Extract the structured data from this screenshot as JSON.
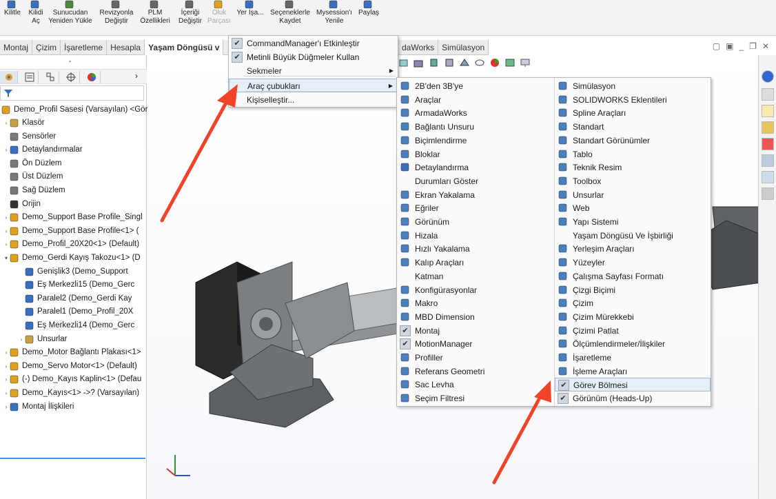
{
  "ribbon": {
    "buttons": [
      {
        "label": "Kilitle",
        "icon": "lock-icon"
      },
      {
        "label": "Kilidi Aç",
        "icon": "unlock-icon"
      },
      {
        "label": "Sunucudan Yeniden Yükle",
        "icon": "reload-icon"
      },
      {
        "label": "Revizyonla Değiştir",
        "icon": "revision-icon"
      },
      {
        "label": "PLM Özellikleri",
        "icon": "properties-icon"
      },
      {
        "label": "İçeriği Değiştir",
        "icon": "content-icon"
      },
      {
        "label": "Oluk Parçası",
        "icon": "part-icon",
        "disabled": true
      },
      {
        "label": "Yer İşa...",
        "icon": "bookmark-icon"
      },
      {
        "label": "Seçeneklerle Kaydet",
        "icon": "save-options-icon"
      },
      {
        "label": "Mysession'ı Yenile",
        "icon": "refresh-icon"
      },
      {
        "label": "Paylaş",
        "icon": "share-icon"
      }
    ]
  },
  "command_tabs": [
    "Montaj",
    "Çizim",
    "İşaretleme",
    "Hesapla",
    "Yaşam Döngüsü v"
  ],
  "command_tabs_right": [
    "daWorks",
    "Simülasyon"
  ],
  "tree": {
    "root": "Demo_Profil Sasesi (Varsayılan) <Gör",
    "items": [
      {
        "label": "Klasör",
        "expand": true,
        "indent": 0,
        "icon": "folder-icon"
      },
      {
        "label": "Sensörler",
        "expand": false,
        "indent": 0,
        "icon": "sensor-icon"
      },
      {
        "label": "Detaylandırmalar",
        "expand": true,
        "indent": 0,
        "icon": "annotation-icon"
      },
      {
        "label": "Ön Düzlem",
        "expand": false,
        "indent": 0,
        "icon": "plane-icon"
      },
      {
        "label": "Üst Düzlem",
        "expand": false,
        "indent": 0,
        "icon": "plane-icon"
      },
      {
        "label": "Sağ Düzlem",
        "expand": false,
        "indent": 0,
        "icon": "plane-icon"
      },
      {
        "label": "Orijin",
        "expand": false,
        "indent": 0,
        "icon": "origin-icon"
      },
      {
        "label": "Demo_Support Base Profile_Singl",
        "expand": true,
        "indent": 0,
        "icon": "part-icon"
      },
      {
        "label": "Demo_Support Base Profile<1> (",
        "expand": true,
        "indent": 0,
        "icon": "part-icon"
      },
      {
        "label": "Demo_Profil_20X20<1> (Default)",
        "expand": true,
        "indent": 0,
        "icon": "part-icon"
      },
      {
        "label": "Demo_Gerdi Kayış Takozu<1> (D",
        "expand": "open",
        "indent": 0,
        "icon": "part-icon"
      },
      {
        "label": "Genişlik3 (Demo_Support",
        "expand": false,
        "indent": 1,
        "icon": "mate-icon"
      },
      {
        "label": "Eş Merkezli15 (Demo_Gerc",
        "expand": false,
        "indent": 1,
        "icon": "mate-icon"
      },
      {
        "label": "Paralel2 (Demo_Gerdi Kay",
        "expand": false,
        "indent": 1,
        "icon": "mate-icon"
      },
      {
        "label": "Paralel1 (Demo_Profil_20X",
        "expand": false,
        "indent": 1,
        "icon": "mate-icon"
      },
      {
        "label": "Eş Merkezli14 (Demo_Gerc",
        "expand": false,
        "indent": 1,
        "icon": "mate-icon"
      },
      {
        "label": "Unsurlar",
        "expand": true,
        "indent": 1,
        "icon": "folder-icon"
      },
      {
        "label": "Demo_Motor Bağlantı Plakası<1>",
        "expand": true,
        "indent": 0,
        "icon": "part-icon"
      },
      {
        "label": "Demo_Servo Motor<1> (Default)",
        "expand": true,
        "indent": 0,
        "icon": "part-icon"
      },
      {
        "label": "(-) Demo_Kayıs Kaplin<1> (Defau",
        "expand": true,
        "indent": 0,
        "icon": "part-icon"
      },
      {
        "label": "Demo_Kayıs<1> ->? (Varsayılan)",
        "expand": true,
        "indent": 0,
        "icon": "part-icon"
      },
      {
        "label": "Montaj İlişkileri",
        "expand": true,
        "indent": 0,
        "icon": "mates-folder-icon"
      }
    ]
  },
  "context_menu": {
    "items": [
      {
        "label": "CommandManager'ı Etkinleştir",
        "checked": true
      },
      {
        "label": "Metinli Büyük Düğmeler Kullan",
        "checked": true
      },
      {
        "label": "Sekmeler",
        "submenu": true
      },
      {
        "label": "Araç çubukları",
        "submenu": true,
        "highlighted": true
      },
      {
        "label": "Kişiselleştir..."
      }
    ]
  },
  "toolbars_menu": {
    "col1": [
      {
        "label": "2B'den 3B'ye",
        "icon": "2d-to-3d-icon"
      },
      {
        "label": "Araçlar",
        "icon": "tools-icon"
      },
      {
        "label": "ArmadaWorks",
        "icon": "armadaworks-icon"
      },
      {
        "label": "Bağlantı Unsuru",
        "icon": "fastener-icon"
      },
      {
        "label": "Biçimlendirme",
        "icon": "format-icon"
      },
      {
        "label": "Bloklar",
        "icon": "blocks-icon"
      },
      {
        "label": "Detaylandırma",
        "icon": "annotation-icon"
      },
      {
        "label": "Durumları Göster",
        "icon": ""
      },
      {
        "label": "Ekran Yakalama",
        "icon": "screen-capture-icon"
      },
      {
        "label": "Eğriler",
        "icon": "curves-icon"
      },
      {
        "label": "Görünüm",
        "icon": "view-icon"
      },
      {
        "label": "Hizala",
        "icon": "align-icon"
      },
      {
        "label": "Hızlı Yakalama",
        "icon": "quick-snap-icon"
      },
      {
        "label": "Kalıp Araçları",
        "icon": "mold-tools-icon"
      },
      {
        "label": "Katman",
        "icon": ""
      },
      {
        "label": "Konfigürasyonlar",
        "icon": "configurations-icon"
      },
      {
        "label": "Makro",
        "icon": "macro-icon"
      },
      {
        "label": "MBD Dimension",
        "icon": "mbd-icon"
      },
      {
        "label": "Montaj",
        "icon": "assembly-icon",
        "checked": true
      },
      {
        "label": "MotionManager",
        "icon": "motion-icon",
        "checked": true
      },
      {
        "label": "Profiller",
        "icon": "profiles-icon"
      },
      {
        "label": "Referans Geometri",
        "icon": "reference-geometry-icon"
      },
      {
        "label": "Sac Levha",
        "icon": "sheet-metal-icon"
      },
      {
        "label": "Seçim Filtresi",
        "icon": "selection-filter-icon"
      }
    ],
    "col2": [
      {
        "label": "Simülasyon",
        "icon": "simulation-icon"
      },
      {
        "label": "SOLIDWORKS Eklentileri",
        "icon": "addins-icon"
      },
      {
        "label": "Spline Araçları",
        "icon": "spline-icon"
      },
      {
        "label": "Standart",
        "icon": "standard-icon"
      },
      {
        "label": "Standart Görünümler",
        "icon": "standard-views-icon"
      },
      {
        "label": "Tablo",
        "icon": "table-icon"
      },
      {
        "label": "Teknik Resim",
        "icon": "drawing-icon"
      },
      {
        "label": "Toolbox",
        "icon": "toolbox-icon"
      },
      {
        "label": "Unsurlar",
        "icon": "features-icon"
      },
      {
        "label": "Web",
        "icon": "web-icon"
      },
      {
        "label": "Yapı Sistemi",
        "icon": "structure-icon"
      },
      {
        "label": "Yaşam Döngüsü Ve İşbirliği",
        "icon": ""
      },
      {
        "label": "Yerleşim Araçları",
        "icon": "layout-icon"
      },
      {
        "label": "Yüzeyler",
        "icon": "surfaces-icon"
      },
      {
        "label": "Çalışma Sayfası Formatı",
        "icon": "sheet-format-icon"
      },
      {
        "label": "Çizgi Biçimi",
        "icon": "line-format-icon"
      },
      {
        "label": "Çizim",
        "icon": "sketch-icon"
      },
      {
        "label": "Çizim Mürekkebi",
        "icon": "sketch-ink-icon"
      },
      {
        "label": "Çizimi Patlat",
        "icon": "explode-sketch-icon"
      },
      {
        "label": "Ölçümlendirmeler/İlişkiler",
        "icon": "dimensions-icon"
      },
      {
        "label": "İşaretleme",
        "icon": "markup-icon"
      },
      {
        "label": "İşleme Araçları",
        "icon": "render-tools-icon"
      },
      {
        "label": "Görev Bölmesi",
        "icon": "",
        "checked": true,
        "highlighted": true
      },
      {
        "label": "Görünüm (Heads-Up)",
        "icon": "",
        "checked": true
      }
    ]
  },
  "colors": {
    "arrow": "#f0442a",
    "highlight": "#e6eef8",
    "tree_underline": "#4a90d9"
  }
}
